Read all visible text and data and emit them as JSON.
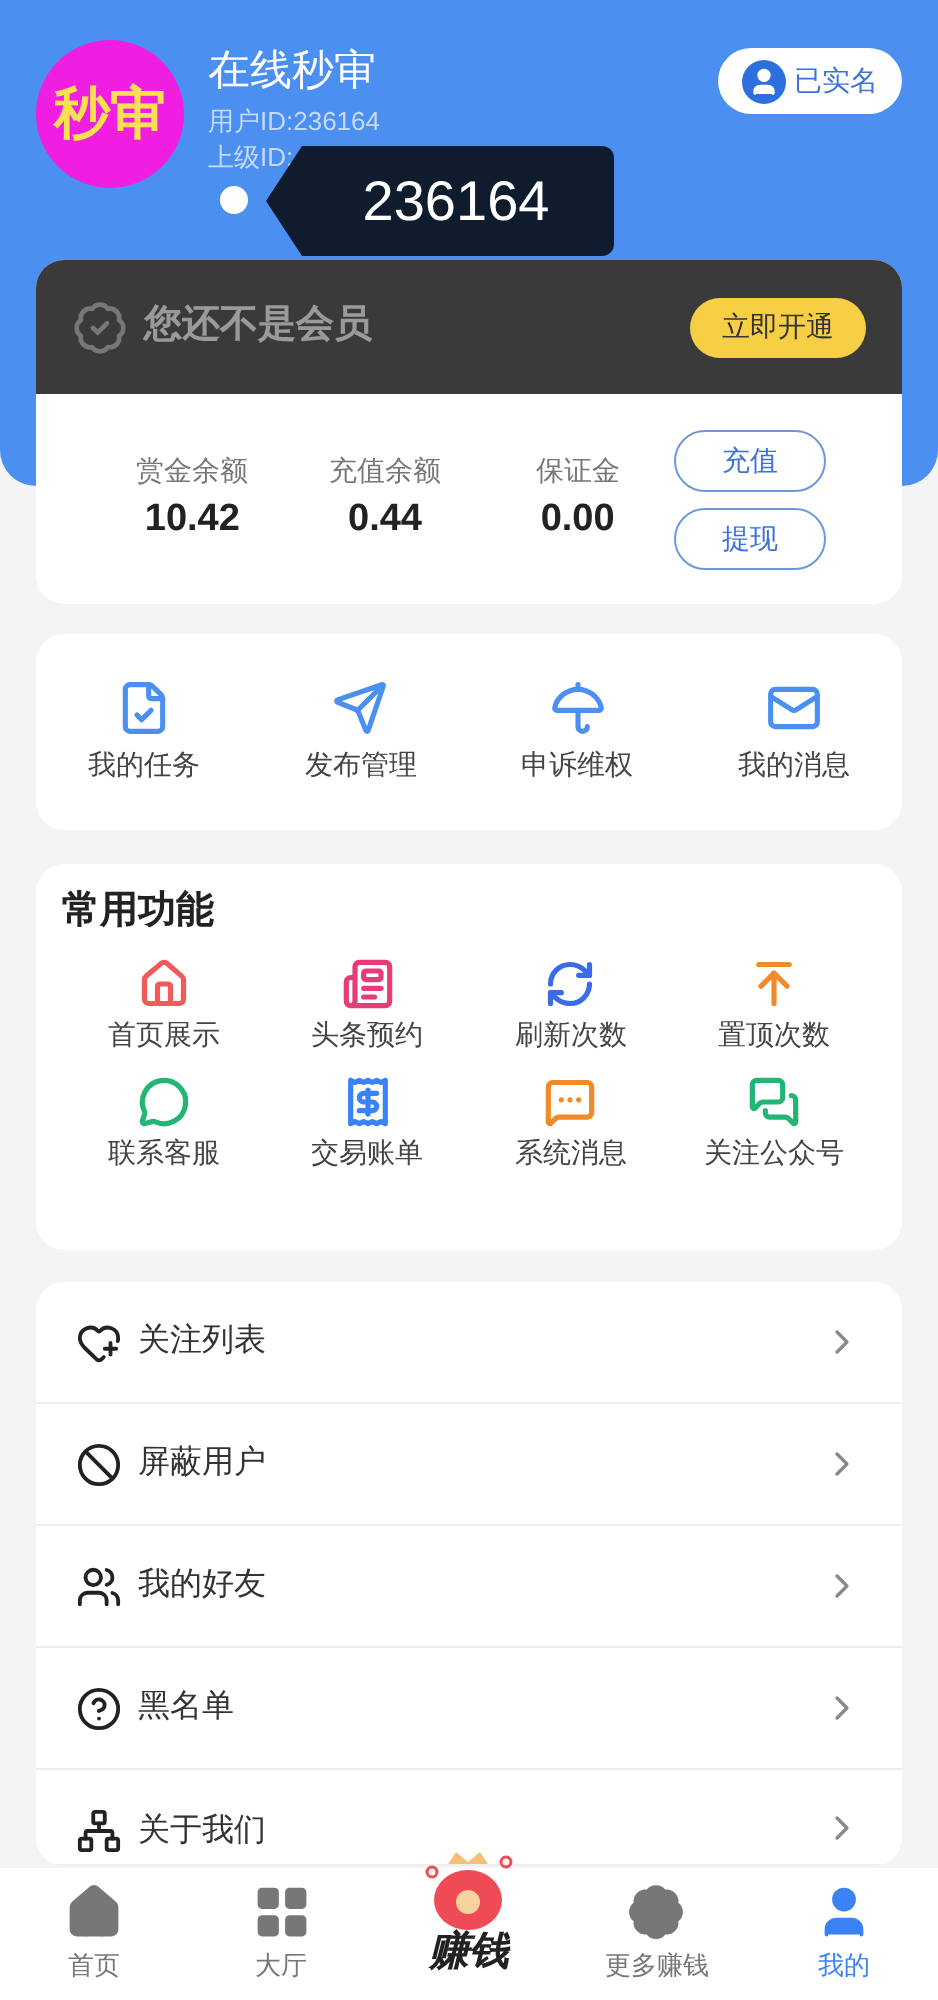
{
  "profile": {
    "avatar_text": "秒审",
    "name": "在线秒审",
    "user_id": "用户ID:236164",
    "parent_id": "上级ID:",
    "verified_button": "已实名",
    "tooltip": "236164"
  },
  "membership": {
    "title": "您还不是会员",
    "button": "立即开通"
  },
  "balances": [
    {
      "label": "赏金余额",
      "value": "10.42"
    },
    {
      "label": "充值余额",
      "value": "0.44"
    },
    {
      "label": "保证金",
      "value": "0.00"
    }
  ],
  "balance_buttons": [
    "充值",
    "提现"
  ],
  "shortcuts": [
    "我的任务",
    "发布管理",
    "申诉维权",
    "我的消息"
  ],
  "common": {
    "title": "常用功能",
    "items": [
      "首页展示",
      "头条预约",
      "刷新次数",
      "置顶次数",
      "联系客服",
      "交易账单",
      "系统消息",
      "关注公众号"
    ]
  },
  "menu": [
    "关注列表",
    "屏蔽用户",
    "我的好友",
    "黑名单",
    "关于我们"
  ],
  "tabbar": [
    {
      "label": "首页",
      "kind": "tab",
      "selected": false
    },
    {
      "label": "大厅",
      "kind": "tab",
      "selected": false
    },
    {
      "label": "赚钱",
      "kind": "center",
      "selected": false
    },
    {
      "label": "更多赚钱",
      "kind": "tab",
      "selected": false
    },
    {
      "label": "我的",
      "kind": "tab",
      "selected": true
    }
  ]
}
